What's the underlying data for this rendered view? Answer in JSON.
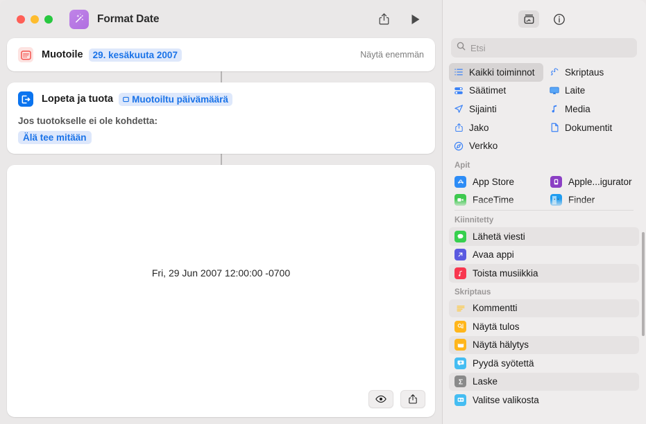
{
  "window": {
    "title": "Format Date",
    "app_icon": "magic-wand-icon",
    "share_icon": "share-icon",
    "run_icon": "play-icon"
  },
  "editor": {
    "action1": {
      "icon": "calendar-icon",
      "title": "Muotoile",
      "token": "29. kesäkuuta 2007",
      "show_more": "Näytä enemmän"
    },
    "action2": {
      "icon": "stop-and-output-icon",
      "title": "Lopeta ja tuota",
      "token": "Muotoiltu päivämäärä",
      "subtitle": "Jos tuotokselle ei ole kohdetta:",
      "chip": "Älä tee mitään"
    },
    "result": {
      "text": "Fri, 29 Jun 2007 12:00:00 -0700",
      "preview_icon": "eye-icon",
      "share_icon": "share-icon"
    }
  },
  "library": {
    "tabs": [
      {
        "name": "action-library-tab",
        "icon": "add-action-icon",
        "active": true
      },
      {
        "name": "info-tab",
        "icon": "info-circle-icon",
        "active": false
      }
    ],
    "search": {
      "placeholder": "Etsi",
      "value": "",
      "icon": "search-icon"
    },
    "categories": [
      {
        "label": "Kaikki toiminnot",
        "icon": "list-icon",
        "selected": true
      },
      {
        "label": "Skriptaus",
        "icon": "scripting-icon",
        "selected": false
      },
      {
        "label": "Säätimet",
        "icon": "controls-icon",
        "selected": false
      },
      {
        "label": "Laite",
        "icon": "display-icon",
        "selected": false
      },
      {
        "label": "Sijainti",
        "icon": "location-arrow-icon",
        "selected": false
      },
      {
        "label": "Media",
        "icon": "music-note-icon",
        "selected": false
      },
      {
        "label": "Jako",
        "icon": "share-icon",
        "selected": false
      },
      {
        "label": "Dokumentit",
        "icon": "document-icon",
        "selected": false
      },
      {
        "label": "Verkko",
        "icon": "safari-compass-icon",
        "selected": false
      }
    ],
    "sections": [
      {
        "title": "Apit",
        "layout": "grid",
        "items": [
          {
            "label": "App Store",
            "icon": "app-store-icon"
          },
          {
            "label": "Apple...igurator",
            "icon": "apple-configurator-icon"
          },
          {
            "label": "FaceTime",
            "icon": "facetime-icon"
          },
          {
            "label": "Finder",
            "icon": "finder-icon"
          }
        ]
      },
      {
        "title": "Kiinnitetty",
        "layout": "list",
        "items": [
          {
            "label": "Lähetä viesti",
            "icon": "messages-icon"
          },
          {
            "label": "Avaa appi",
            "icon": "open-app-icon"
          },
          {
            "label": "Toista musiikkia",
            "icon": "music-icon"
          }
        ]
      },
      {
        "title": "Skriptaus",
        "layout": "list",
        "items": [
          {
            "label": "Kommentti",
            "icon": "comment-lines-icon"
          },
          {
            "label": "Näytä tulos",
            "icon": "show-result-icon"
          },
          {
            "label": "Näytä hälytys",
            "icon": "alert-window-icon"
          },
          {
            "label": "Pyydä syötettä",
            "icon": "ask-input-icon"
          },
          {
            "label": "Laske",
            "icon": "calculate-sigma-icon"
          },
          {
            "label": "Valitse valikosta",
            "icon": "choose-from-menu-icon"
          }
        ]
      }
    ]
  },
  "colors": {
    "accent_blue": "#1a73e8",
    "action_blue": "#0b74ef",
    "calendar_red": "#f4524d",
    "app_purple": "#b06fe0",
    "yellow": "#ffb61c",
    "green": "#3ec94f",
    "pink_red": "#f8374f",
    "cyan": "#45bdf2",
    "gray": "#8a8a8a",
    "indigo": "#5856d6"
  }
}
